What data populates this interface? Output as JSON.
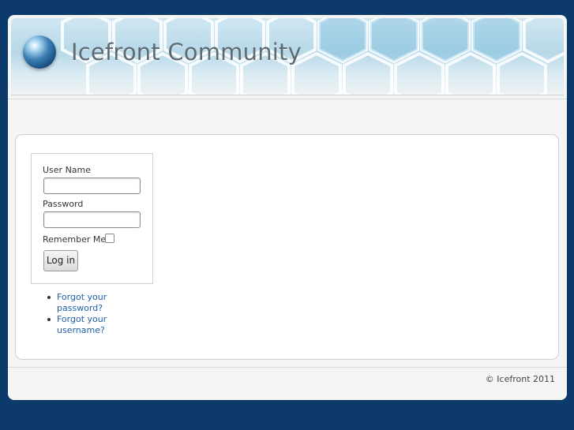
{
  "site": {
    "title": "Icefront Community"
  },
  "login": {
    "username_label": "User Name",
    "username_value": "",
    "password_label": "Password",
    "password_value": "",
    "remember_label": "Remember Me",
    "remember_checked": false,
    "submit_label": "Log in"
  },
  "links": [
    {
      "label": "Forgot your password?"
    },
    {
      "label": "Forgot your username?"
    }
  ],
  "footer": {
    "copyright": "© Icefront 2011"
  },
  "colors": {
    "page_background": "#0b3a6b",
    "link": "#1f5fa8",
    "title_text": "#5e6a72"
  },
  "icons": {
    "logo": "globe-icon"
  }
}
